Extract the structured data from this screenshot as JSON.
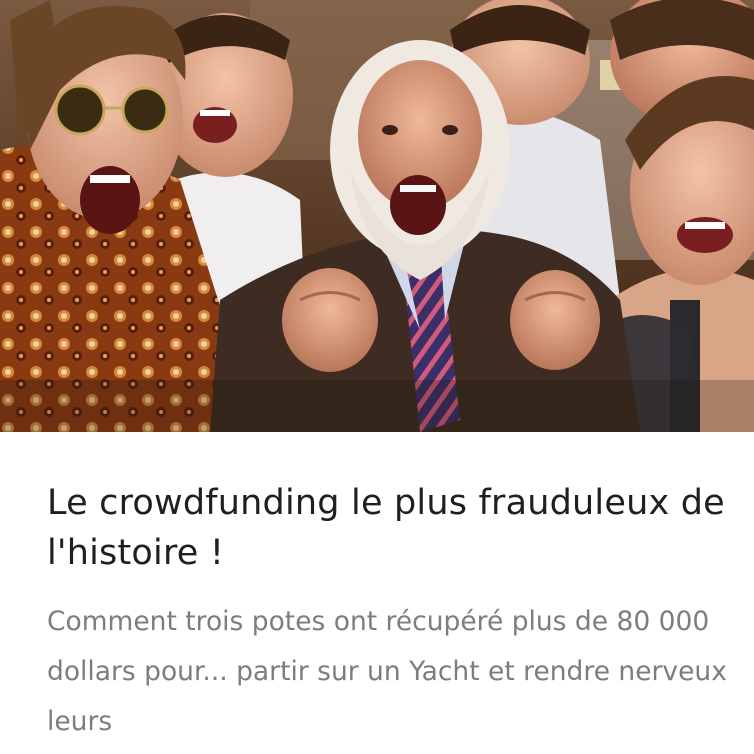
{
  "article": {
    "image": {
      "alt": "",
      "subject": "group-of-people-cheering-photo",
      "colors": {
        "background_top": "#6b4a33",
        "background_bottom": "#3b2418",
        "suit": "#3a2a20",
        "hair": "#e9e4dc",
        "skin": "#e8b49a",
        "shirt_pattern": "#b8561d"
      }
    },
    "title": "Le crowdfunding le plus frauduleux de l'histoire !",
    "excerpt": "Comment trois potes ont récupéré plus de 80 000 dollars pour... partir sur un Yacht et rendre nerveux leurs"
  }
}
